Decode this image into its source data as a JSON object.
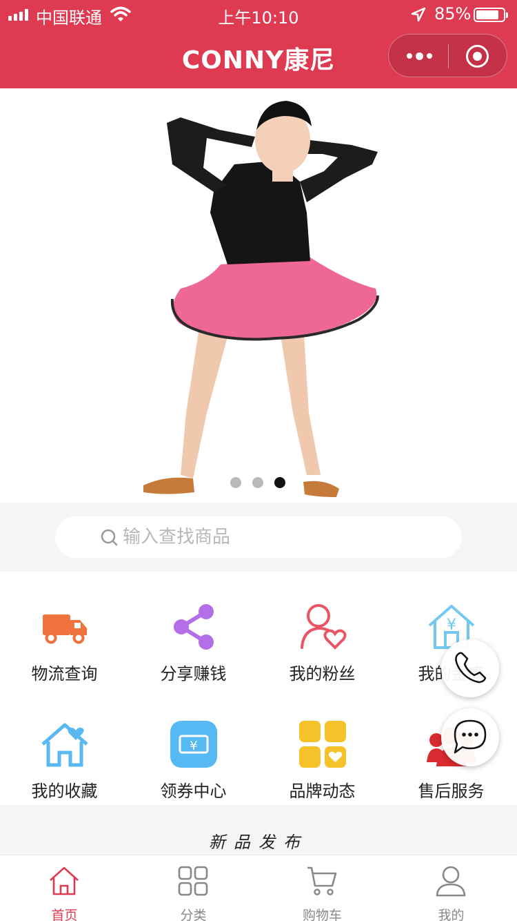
{
  "status_bar": {
    "carrier": "中国联通",
    "time": "上午10:10",
    "battery": "85%",
    "battery_level": 0.85
  },
  "header": {
    "title": "CONNY康尼"
  },
  "banner": {
    "slide_count": 3,
    "active_index": 2
  },
  "search": {
    "placeholder": "输入查找商品"
  },
  "menu": [
    {
      "label": "物流查询",
      "icon": "truck-icon",
      "color": "#f0723c"
    },
    {
      "label": "分享赚钱",
      "icon": "share-icon",
      "color": "#b46ee8"
    },
    {
      "label": "我的粉丝",
      "icon": "fans-icon",
      "color": "#ea5565"
    },
    {
      "label": "我的金库",
      "icon": "vault-icon",
      "color": "#74c7ef"
    },
    {
      "label": "我的收藏",
      "icon": "favorite-house-icon",
      "color": "#5ab8f0"
    },
    {
      "label": "领券中心",
      "icon": "coupon-icon",
      "color": "#57b9f3"
    },
    {
      "label": "品牌动态",
      "icon": "brand-icon",
      "color": "#f6c22a"
    },
    {
      "label": "售后服务",
      "icon": "service-icon",
      "color": "#d92a2f"
    }
  ],
  "section": {
    "title": "新品发布"
  },
  "tabbar": [
    {
      "label": "首页",
      "icon": "home-icon",
      "active": true
    },
    {
      "label": "分类",
      "icon": "category-icon",
      "active": false
    },
    {
      "label": "购物车",
      "icon": "cart-icon",
      "active": false
    },
    {
      "label": "我的",
      "icon": "user-icon",
      "active": false
    }
  ],
  "colors": {
    "brand_red": "#de3a52",
    "tab_inactive": "#888888"
  }
}
